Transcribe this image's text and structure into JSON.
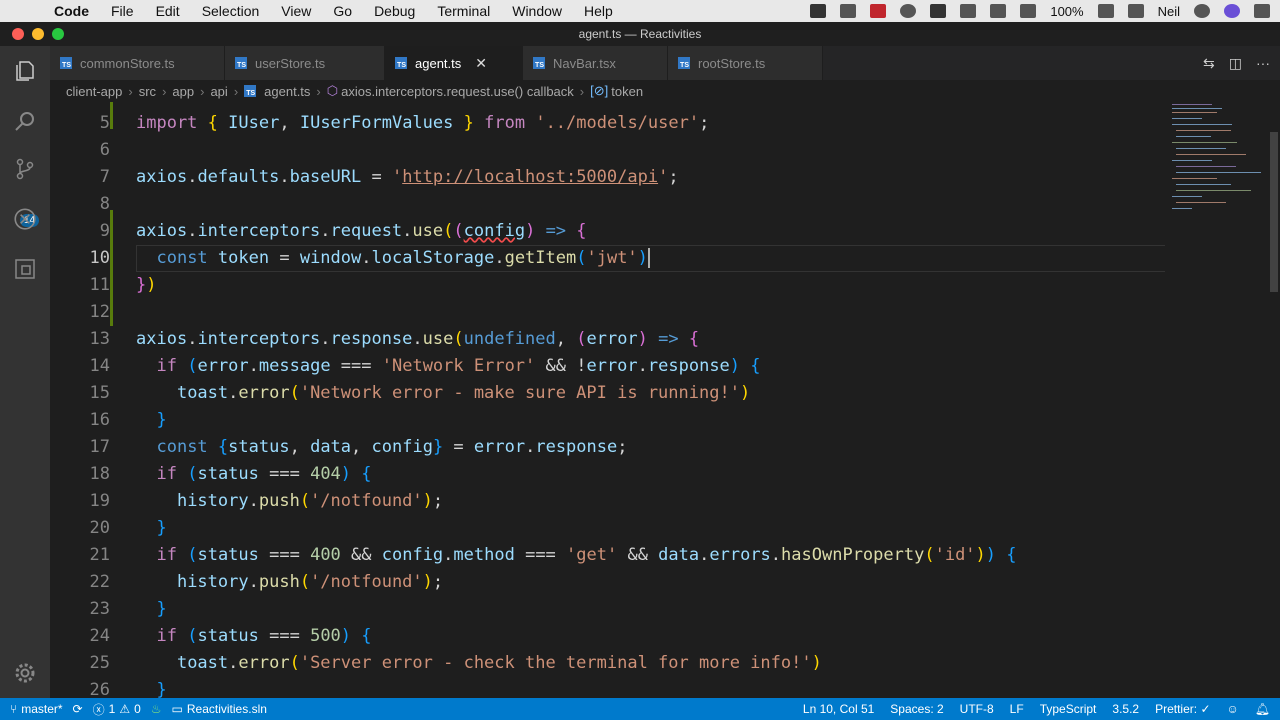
{
  "menubar": {
    "app_name": "Code",
    "items": [
      "File",
      "Edit",
      "Selection",
      "View",
      "Go",
      "Debug",
      "Terminal",
      "Window",
      "Help"
    ],
    "battery": "100%",
    "user": "Neil"
  },
  "window": {
    "title": "agent.ts — Reactivities"
  },
  "tabs": [
    {
      "label": "commonStore.ts",
      "active": false
    },
    {
      "label": "userStore.ts",
      "active": false
    },
    {
      "label": "agent.ts",
      "active": true
    },
    {
      "label": "NavBar.tsx",
      "active": false
    },
    {
      "label": "rootStore.ts",
      "active": false
    }
  ],
  "breadcrumb": [
    "client-app",
    "src",
    "app",
    "api",
    "agent.ts",
    "axios.interceptors.request.use() callback",
    "token"
  ],
  "activity": {
    "scm_badge": "14"
  },
  "editor": {
    "lines": [
      {
        "n": "5"
      },
      {
        "n": "6"
      },
      {
        "n": "7"
      },
      {
        "n": "8"
      },
      {
        "n": "9"
      },
      {
        "n": "10"
      },
      {
        "n": "11"
      },
      {
        "n": "12"
      },
      {
        "n": "13"
      },
      {
        "n": "14"
      },
      {
        "n": "15"
      },
      {
        "n": "16"
      },
      {
        "n": "17"
      },
      {
        "n": "18"
      },
      {
        "n": "19"
      },
      {
        "n": "20"
      },
      {
        "n": "21"
      },
      {
        "n": "22"
      },
      {
        "n": "23"
      },
      {
        "n": "24"
      },
      {
        "n": "25"
      },
      {
        "n": "26"
      }
    ]
  },
  "statusbar": {
    "branch": "master*",
    "errors": "1",
    "warnings": "0",
    "solution": "Reactivities.sln",
    "position": "Ln 10, Col 51",
    "spaces": "Spaces: 2",
    "encoding": "UTF-8",
    "eol": "LF",
    "language": "TypeScript",
    "version": "3.5.2",
    "formatter": "Prettier: ✓"
  }
}
